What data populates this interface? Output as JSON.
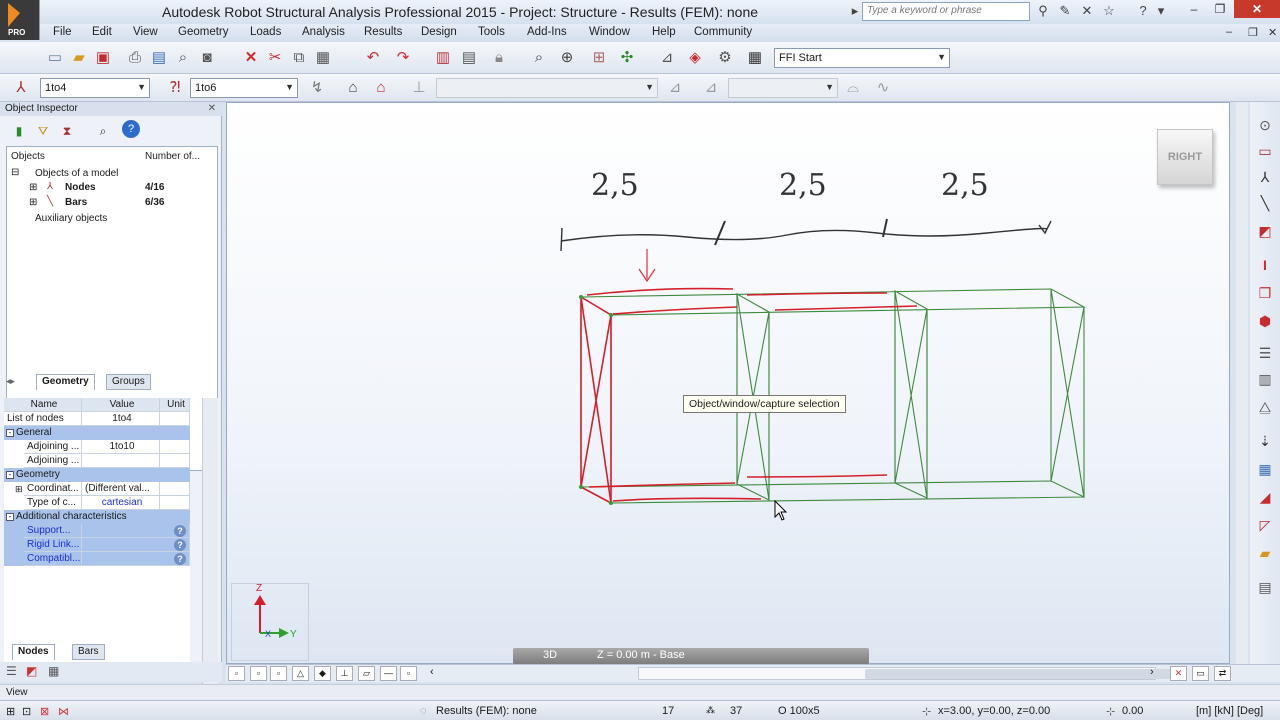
{
  "window": {
    "title": "Autodesk Robot Structural Analysis Professional 2015 - Project: Structure - Results (FEM): none",
    "logo_text": "PRO",
    "search_placeholder": "Type a keyword or phrase"
  },
  "menu": [
    "File",
    "Edit",
    "View",
    "Geometry",
    "Loads",
    "Analysis",
    "Results",
    "Design",
    "Tools",
    "Add-Ins",
    "Window",
    "Help",
    "Community"
  ],
  "toolbar1": {
    "layout_select": "FFI Start"
  },
  "toolbar2": {
    "nodes_select": "1to4",
    "bars_select": "1to6"
  },
  "object_inspector": {
    "title": "Object Inspector",
    "col_objects": "Objects",
    "col_number": "Number of...",
    "root": "Objects of a model",
    "nodes": {
      "label": "Nodes",
      "count": "4/16"
    },
    "bars": {
      "label": "Bars",
      "count": "6/36"
    },
    "auxiliary": "Auxiliary objects",
    "tabs": [
      "Geometry",
      "Groups"
    ]
  },
  "properties": {
    "headers": [
      "Name",
      "Value",
      "Unit"
    ],
    "list_of_nodes": {
      "name": "List of nodes",
      "value": "1to4"
    },
    "group_general": "General",
    "adjoining1": {
      "name": "Adjoining ...",
      "value": "1to10"
    },
    "adjoining2": {
      "name": "Adjoining ...",
      "value": ""
    },
    "group_geometry": "Geometry",
    "coordinates": {
      "name": "Coordinat...",
      "value": "(Different val..."
    },
    "type_of_coord": {
      "name": "Type of c...",
      "value": "cartesian"
    },
    "group_additional": "Additional characteristics",
    "support": "Support...",
    "rigid_links": "Rigid Link...",
    "compatible": "Compatibl...",
    "bottom_tabs": [
      "Nodes",
      "Bars"
    ]
  },
  "view": {
    "cube_label": "RIGHT",
    "tooltip": "Object/window/capture selection",
    "mode": "3D",
    "plane": "Z = 0.00 m - Base",
    "axis_z": "Z",
    "axis_x": "X",
    "axis_y": "Y",
    "dimension_labels": [
      "2,5",
      "2,5",
      "2,5"
    ]
  },
  "status": {
    "view_label": "View",
    "results": "Results (FEM): none",
    "count1": "17",
    "count2": "37",
    "section": "O 100x5",
    "coords": "x=3.00, y=0.00, z=0.00",
    "angle": "0.00",
    "units": "[m] [kN] [Deg]"
  },
  "colors": {
    "selected": "#d4202a",
    "structure": "#2c7a2c",
    "accent": "#f08a1c"
  }
}
